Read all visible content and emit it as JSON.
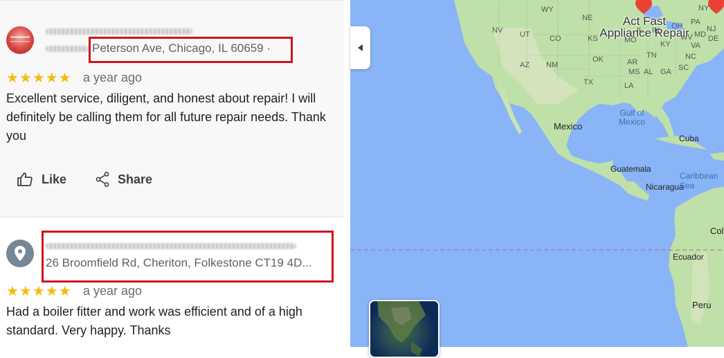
{
  "reviews": [
    {
      "address": "Peterson Ave, Chicago, IL 60659 ·",
      "rating_stars": "★★★★★",
      "rating": 5,
      "time": "a year ago",
      "text": "Excellent service, diligent, and honest about repair! I will definitely be calling them for all future repair needs. Thank you",
      "like_label": "Like",
      "share_label": "Share"
    },
    {
      "address": "26 Broomfield Rd, Cheriton, Folkestone CT19 4D...",
      "rating_stars": "★★★★★",
      "rating": 5,
      "time": "a year ago",
      "text": "Had a boiler fitter and work was efficient and of a high standard. Very happy. Thanks"
    }
  ],
  "map": {
    "place_name_line1": "Act Fast",
    "place_name_line2": "Appliance Repair",
    "labels": {
      "nv": "NV",
      "ut": "UT",
      "wy": "WY",
      "co": "CO",
      "ks": "KS",
      "ok": "OK",
      "az": "AZ",
      "nm": "NM",
      "tx": "TX",
      "mo": "MO",
      "tn": "TN",
      "ar": "AR",
      "ms": "MS",
      "al": "AL",
      "ga": "GA",
      "la": "LA",
      "sc": "SC",
      "nc": "NC",
      "va": "VA",
      "wv": "WV",
      "ky": "KY",
      "in": "IN",
      "il": "IL",
      "oh": "OH",
      "pa": "PA",
      "md": "MD",
      "nj": "NJ",
      "de": "DE",
      "ny": "NY",
      "ne": "NE",
      "gulf": "Gulf of\nMexico",
      "mexico": "Mexico",
      "cuba": "Cuba",
      "guatemala": "Guatemala",
      "nicaragua": "Nicaragua",
      "caribbean": "Caribbean Sea",
      "colombia": "Colom",
      "ecuador": "Ecuador",
      "peru": "Peru"
    },
    "colors": {
      "water": "#8ab4f8",
      "land": "#bfe0a8",
      "pin": "#ea4335",
      "annotation_box": "#d0121b"
    }
  }
}
